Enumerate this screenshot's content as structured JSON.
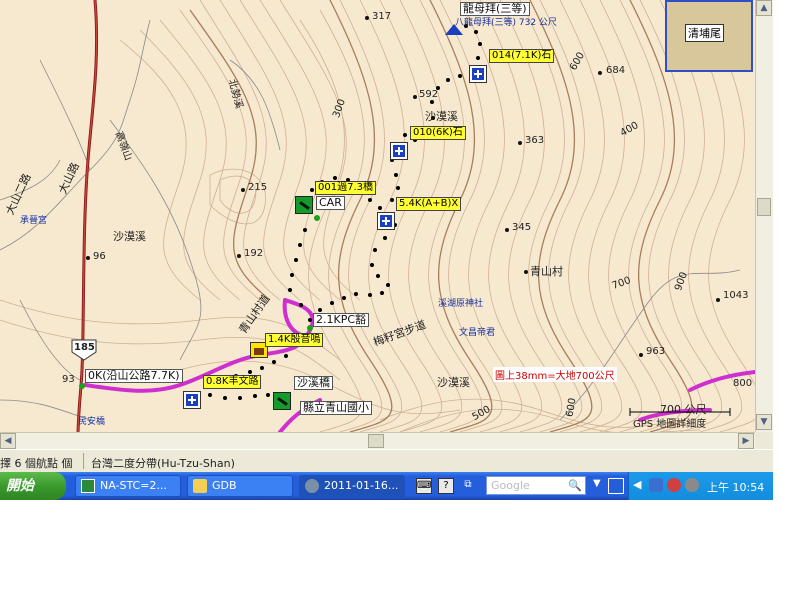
{
  "map": {
    "labels": {
      "l317": "317",
      "l684": "684",
      "l592": "592",
      "l363": "363",
      "l400": "400",
      "l600": "600",
      "l300": "300",
      "l215": "215",
      "l192": "192",
      "l96": "96",
      "l345": "345",
      "l700": "700",
      "l900": "900",
      "l1043": "1043",
      "l963": "963",
      "l93": "93",
      "l185": "185",
      "l800": "800",
      "l500": "500",
      "l600b": "600",
      "shamoxi1": "沙漠溪",
      "shamoxi2": "沙漠溪",
      "shamoxi3": "沙漠溪",
      "qingshancun": "青山村",
      "dashanlu": "大山路",
      "shiqilu": "大山二路",
      "meiziping": "梅籽宮步道",
      "xishanshenmiao": "溪湖原神社",
      "wenqibei": "文昌帝君",
      "minanqiao": "民安橋",
      "chengjingsi": "承晉宮",
      "gaolishan": "高嶺山",
      "bizhi": "北勢溪",
      "scale_text": "圖上38mm=大地700公尺",
      "ruler_text": "700 公尺",
      "ruler_sub": "GPS 地圖詳細度",
      "top_station": "龍母拜(三等)",
      "top_station_sub": "八龍母拜(三等) 732 公尺"
    },
    "waypoints": {
      "w014": "014(7.1K)石",
      "w010": "010(6K)石",
      "w5_4": "5.4K(A+B)X",
      "w001": "001過7.3橋",
      "car": "CAR",
      "w2_1": "2.1KPC豁",
      "w1_4": "1.4K殷音嗚",
      "w0k": "0K(沿山公路7.7K)",
      "w0_8": "0.8K丰文路",
      "shamoxi_bridge": "沙溪橋",
      "school": "縣立青山國小",
      "xiangtang": "青山村道"
    },
    "minimap_label": "清埔尾"
  },
  "status": {
    "left": "擇 6 個航點 個",
    "datum": "台灣二度分帶(Hu-Tzu-Shan)"
  },
  "taskbar": {
    "start": "開始",
    "tasks": [
      {
        "label": "NA-STC=2...",
        "icon": "map-app-icon"
      },
      {
        "label": "GDB",
        "icon": "folder-icon"
      },
      {
        "label": "2011-01-16...",
        "icon": "map-app-icon"
      }
    ],
    "search_placeholder": "Google",
    "clock": "上午 10:54"
  }
}
